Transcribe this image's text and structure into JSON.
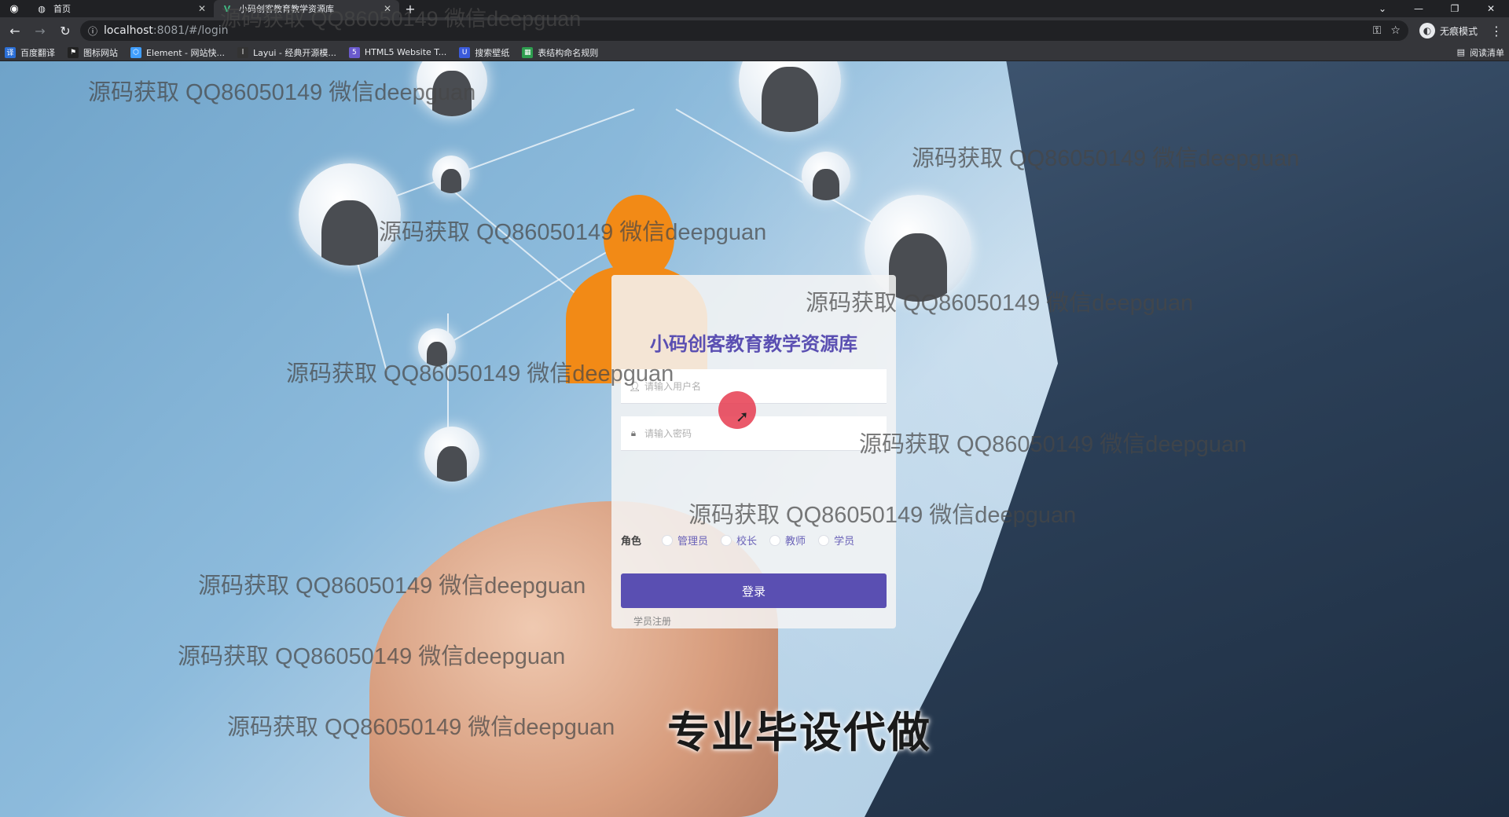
{
  "browser": {
    "tabs": [
      {
        "title": "首页",
        "icon": "globe-icon"
      },
      {
        "title": "小码创客教育教学资源库",
        "icon": "vue-icon"
      }
    ],
    "url_host": "localhost",
    "url_rest": ":8081/#/login",
    "incognito_label": "无痕模式",
    "bookmarks": [
      {
        "label": "百度翻译",
        "color": "#2b6fd6"
      },
      {
        "label": "图标网站",
        "color": "#222222"
      },
      {
        "label": "Element - 网站快...",
        "color": "#409eff"
      },
      {
        "label": "Layui - 经典开源模...",
        "color": "#333333"
      },
      {
        "label": "HTML5 Website T...",
        "color": "#6a5acd"
      },
      {
        "label": "搜索壁纸",
        "color": "#3b5bdb"
      },
      {
        "label": "表结构命名规则",
        "color": "#2e9e4f"
      }
    ],
    "reading_list": "阅读清单"
  },
  "login": {
    "title": "小码创客教育教学资源库",
    "username_placeholder": "请输入用户名",
    "password_placeholder": "请输入密码",
    "role_label": "角色",
    "roles": [
      "管理员",
      "校长",
      "教师",
      "学员"
    ],
    "login_button": "登录",
    "register_link": "学员注册"
  },
  "overlay": {
    "watermark": "源码获取 QQ86050149 微信deepguan",
    "caption": "专业毕设代做"
  },
  "colors": {
    "accent": "#5a4fb2",
    "browser_dark": "#202124",
    "browser_toolbar": "#35363a"
  }
}
